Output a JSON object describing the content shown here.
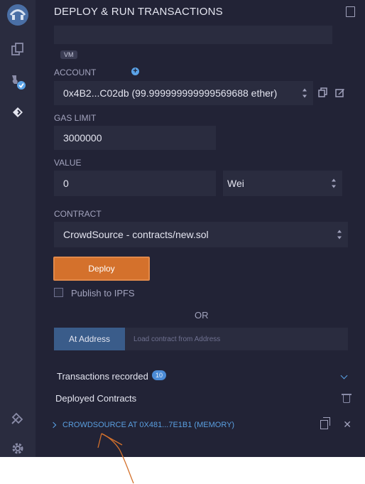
{
  "panel": {
    "title": "DEPLOY & RUN TRANSACTIONS"
  },
  "environment": {
    "value": "",
    "badge": "VM"
  },
  "account": {
    "label": "ACCOUNT",
    "value": "0x4B2...C02db (99.999999999999569688 ether)"
  },
  "gas_limit": {
    "label": "GAS LIMIT",
    "value": "3000000"
  },
  "value": {
    "label": "VALUE",
    "amount": "0",
    "unit": "Wei"
  },
  "contract": {
    "label": "CONTRACT",
    "value": "CrowdSource - contracts/new.sol"
  },
  "actions": {
    "deploy_label": "Deploy",
    "publish_label": "Publish to IPFS",
    "or_label": "OR",
    "at_address_label": "At Address",
    "at_address_placeholder": "Load contract from Address"
  },
  "transactions": {
    "label": "Transactions recorded",
    "count": "10"
  },
  "deployed": {
    "label": "Deployed Contracts",
    "instances": [
      {
        "label": "CROWDSOURCE AT 0X481...7E1B1 (MEMORY)"
      }
    ]
  },
  "colors": {
    "accent": "#d4712c",
    "link": "#5a9fe0",
    "background": "#222336",
    "field": "#2a2c3f"
  },
  "icons": [
    "remix-logo-icon",
    "file-explorer-icon",
    "compiler-icon",
    "deploy-icon",
    "plugin-icon",
    "settings-icon",
    "book-icon",
    "plus-circle-icon",
    "copy-icon",
    "edit-icon",
    "chevron-down-icon",
    "trash-icon",
    "chevron-right-icon",
    "close-icon"
  ]
}
